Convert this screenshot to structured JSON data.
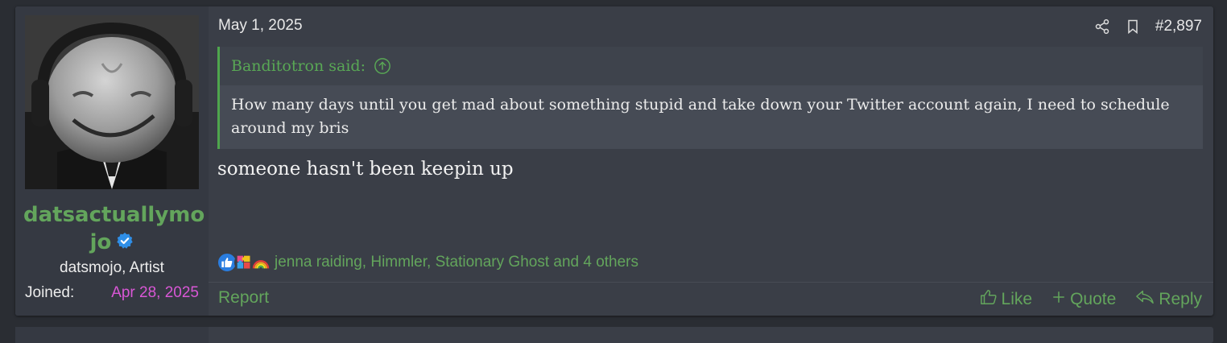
{
  "post": {
    "author": {
      "name": "datsactuallymojo",
      "name_line1": "datsactuallymo",
      "name_line2": "jo",
      "title": "datsmojo, Artist",
      "joined_label": "Joined:",
      "joined_date": "Apr 28, 2025",
      "verified_icon": "verified-check-icon",
      "colors": {
        "name": "#63a55c",
        "joined_date": "#d957d6"
      }
    },
    "date": "May 1, 2025",
    "number": "#2,897",
    "header_icons": [
      "share-icon",
      "bookmark-icon"
    ],
    "quote": {
      "author": "Banditotron said:",
      "jump_icon": "arrow-up-circle-icon",
      "text": "How many days until you get mad about something stupid and take down your Twitter account again, I need to schedule around my bris"
    },
    "body": "someone hasn't been keepin up",
    "reactions": {
      "icons": [
        "like-icon",
        "puzzle-icon",
        "rainbow-icon"
      ],
      "names": "jenna raiding, Himmler, Stationary Ghost and 4 others"
    },
    "footer": {
      "report": "Report",
      "like": "Like",
      "quote": "Quote",
      "reply": "Reply"
    }
  },
  "colors": {
    "background": "#2a2d33",
    "panel": "#3a3e47",
    "accent_green": "#63a55c",
    "quote_bar": "#4fa64d"
  }
}
